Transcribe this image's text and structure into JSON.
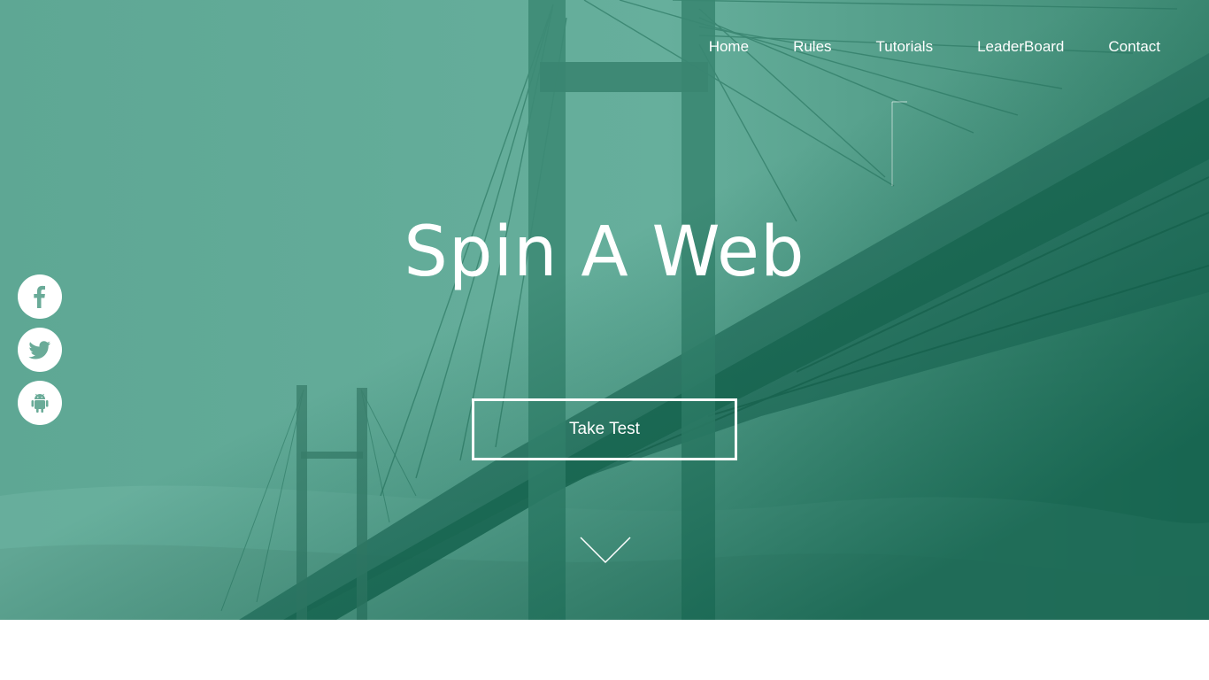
{
  "nav": {
    "items": [
      {
        "label": "Home"
      },
      {
        "label": "Rules"
      },
      {
        "label": "Tutorials"
      },
      {
        "label": "LeaderBoard"
      },
      {
        "label": "Contact"
      }
    ]
  },
  "hero": {
    "title": "Spin A Web",
    "cta_label": "Take Test",
    "scroll_icon": "chevron-down-icon",
    "background_image": "bridge-photo"
  },
  "social": {
    "icons": [
      "facebook-icon",
      "twitter-icon",
      "android-icon"
    ]
  },
  "colors": {
    "overlay": "#63ad99",
    "overlay_dark": "#0b5a45",
    "icon": "#6aab98",
    "text": "#ffffff"
  }
}
